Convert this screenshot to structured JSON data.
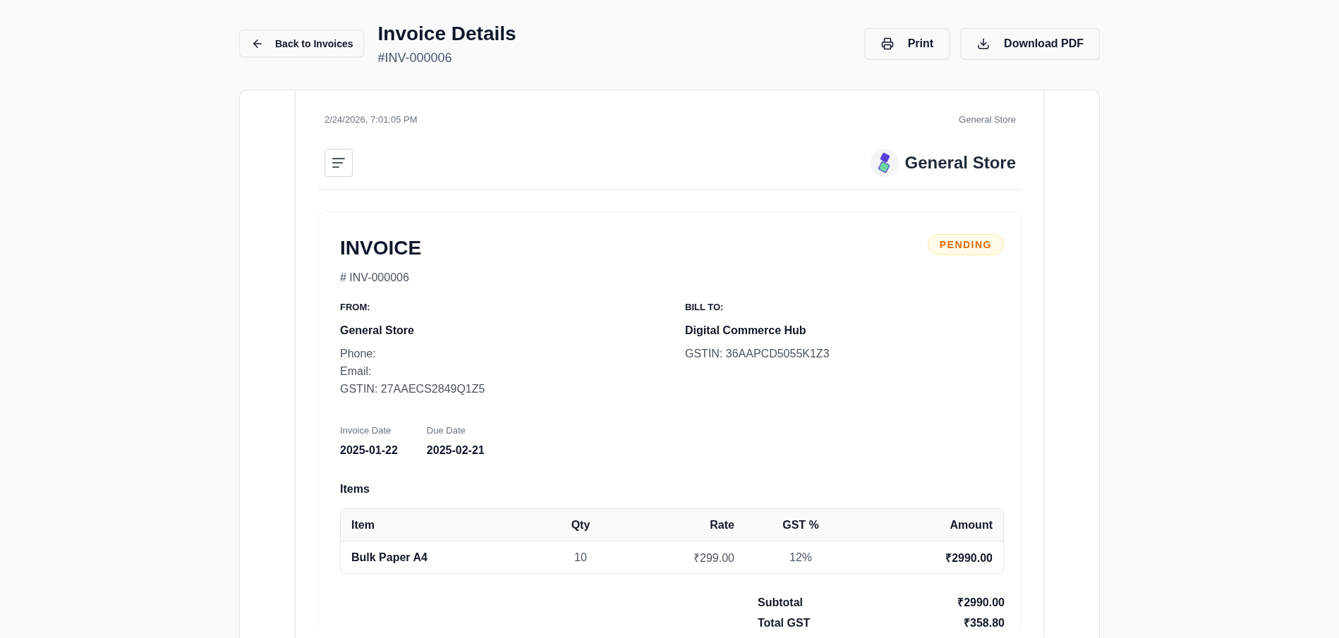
{
  "header": {
    "back_button": "Back to Invoices",
    "title": "Invoice Details",
    "invoice_ref": "#INV-000006",
    "actions": [
      {
        "kind": "print",
        "label": "Print"
      },
      {
        "kind": "download",
        "label": "Download PDF"
      }
    ]
  },
  "document": {
    "timestamp": "2/24/2026, 7:01:05 PM",
    "header_store": "General Store",
    "store_name": "General Store"
  },
  "invoice": {
    "title": "INVOICE",
    "number": "# INV-000006",
    "status": {
      "label": "PENDING",
      "kind": "pending"
    },
    "from": {
      "heading": "FROM:",
      "name": "General Store",
      "lines": [
        "Phone:",
        "Email:",
        "GSTIN: 27AAECS2849Q1Z5"
      ]
    },
    "bill_to": {
      "heading": "BILL TO:",
      "name": "Digital Commerce Hub",
      "lines": [
        "GSTIN: 36AAPCD5055K1Z3"
      ]
    },
    "dates": [
      {
        "label": "Invoice Date",
        "value": "2025-01-22"
      },
      {
        "label": "Due Date",
        "value": "2025-02-21"
      }
    ],
    "items_heading": "Items",
    "table": {
      "columns": [
        "Item",
        "Qty",
        "Rate",
        "GST %",
        "Amount"
      ],
      "rows": [
        [
          "Bulk Paper A4",
          "10",
          "₹299.00",
          "12%",
          "₹2990.00"
        ]
      ]
    },
    "totals": [
      {
        "label": "Subtotal",
        "value": "₹2990.00"
      },
      {
        "label": "Total GST",
        "value": "₹358.80"
      }
    ]
  }
}
